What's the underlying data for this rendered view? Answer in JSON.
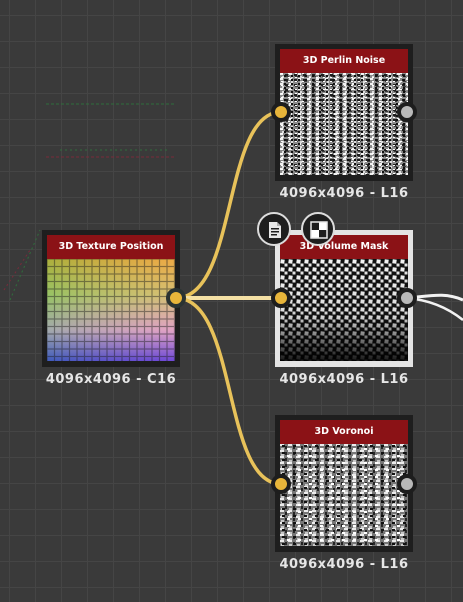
{
  "colors": {
    "canvas": "#3a3a3a",
    "title_bar": "#8b1216",
    "port_active": "#e8b53a",
    "port_idle": "#b9b9b9",
    "wire": "#e8c25a",
    "wire_selected": "#f4e0a4",
    "wire_out": "#f2f2f2"
  },
  "nodes": {
    "texture_position": {
      "title": "3D Texture Position",
      "resolution": "4096x4096 - C16"
    },
    "perlin_noise": {
      "title": "3D Perlin Noise",
      "resolution": "4096x4096 - L16"
    },
    "volume_mask": {
      "title": "3D Volume Mask",
      "resolution": "4096x4096 - L16",
      "selected": true
    },
    "voronoi": {
      "title": "3D Voronoi",
      "resolution": "4096x4096 - L16"
    }
  },
  "toolbar": {
    "icons": [
      "document-icon",
      "checker-preview-icon"
    ]
  }
}
